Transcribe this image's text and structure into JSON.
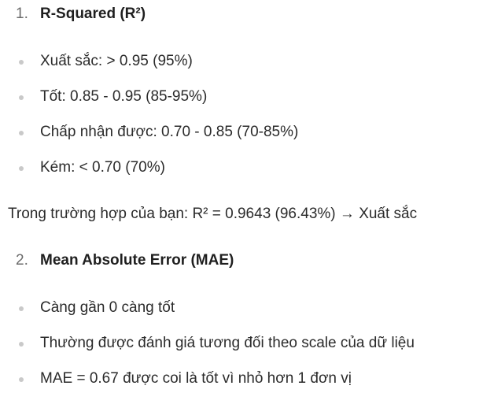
{
  "section1": {
    "number": "1.",
    "title": "R-Squared (R²)",
    "bullets": [
      "Xuất sắc: > 0.95 (95%)",
      "Tốt: 0.85 - 0.95 (85-95%)",
      "Chấp nhận được: 0.70 - 0.85 (70-85%)",
      "Kém: < 0.70 (70%)"
    ]
  },
  "paragraph": "Trong trường hợp của bạn: R² = 0.9643 (96.43%) → Xuất sắc",
  "section2": {
    "number": "2.",
    "title": "Mean Absolute Error (MAE)",
    "bullets": [
      "Càng gần 0 càng tốt",
      "Thường được đánh giá tương đối theo scale của dữ liệu",
      "MAE = 0.67 được coi là tốt vì nhỏ hơn 1 đơn vị"
    ]
  }
}
